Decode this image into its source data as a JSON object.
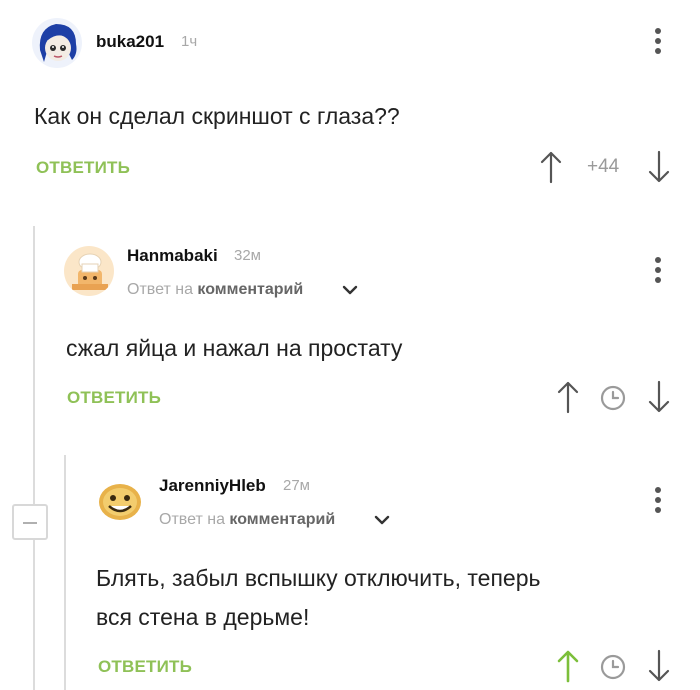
{
  "comments": [
    {
      "username": "buka201",
      "time": "1ч",
      "text": "Как он сделал скриншот с глаза??",
      "reply_label": "ОТВЕТИТЬ",
      "rating": "+44"
    },
    {
      "username": "Hanmabaki",
      "time": "32м",
      "reply_prefix": "Ответ на",
      "reply_target": "комментарий",
      "text": "сжал яйца и нажал на простату",
      "reply_label": "ОТВЕТИТЬ"
    },
    {
      "username": "JarenniyHleb",
      "time": "27м",
      "reply_prefix": "Ответ на",
      "reply_target": "комментарий",
      "text_line1": "Блять, забыл вспышку отключить, теперь",
      "text_line2": "вся стена в дерьме!",
      "reply_label": "ОТВЕТИТЬ"
    }
  ],
  "colors": {
    "accent": "#8fc157",
    "muted": "#a8a8a8",
    "upvoted": "#7cbf3a"
  }
}
